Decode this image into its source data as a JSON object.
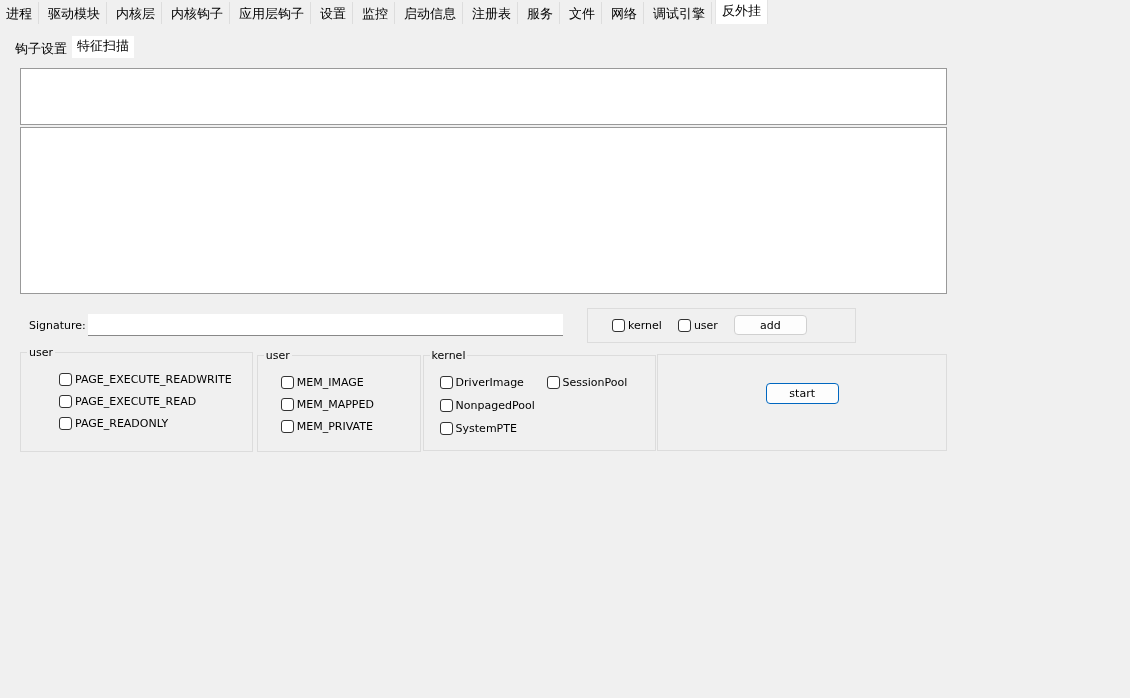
{
  "tabs": [
    {
      "label": "进程",
      "selected": false
    },
    {
      "label": "驱动模块",
      "selected": false
    },
    {
      "label": "内核层",
      "selected": false
    },
    {
      "label": "内核钩子",
      "selected": false
    },
    {
      "label": "应用层钩子",
      "selected": false
    },
    {
      "label": "设置",
      "selected": false
    },
    {
      "label": "监控",
      "selected": false
    },
    {
      "label": "启动信息",
      "selected": false
    },
    {
      "label": "注册表",
      "selected": false
    },
    {
      "label": "服务",
      "selected": false
    },
    {
      "label": "文件",
      "selected": false
    },
    {
      "label": "网络",
      "selected": false
    },
    {
      "label": "调试引擎",
      "selected": false
    },
    {
      "label": "反外挂",
      "selected": true
    }
  ],
  "subtabs": [
    {
      "label": "钩子设置",
      "selected": false
    },
    {
      "label": "特征扫描",
      "selected": true
    }
  ],
  "signature": {
    "label": "Signature:"
  },
  "add_panel": {
    "options": [
      {
        "label": "kernel",
        "checked": false
      },
      {
        "label": "user",
        "checked": false
      }
    ],
    "button": "add"
  },
  "groups": [
    {
      "title": "user",
      "kind": "list",
      "options": [
        {
          "label": "PAGE_EXECUTE_READWRITE",
          "checked": false
        },
        {
          "label": "PAGE_EXECUTE_READ",
          "checked": false
        },
        {
          "label": "PAGE_READONLY",
          "checked": false
        }
      ]
    },
    {
      "title": "user",
      "kind": "list",
      "options": [
        {
          "label": "MEM_IMAGE",
          "checked": false
        },
        {
          "label": "MEM_MAPPED",
          "checked": false
        },
        {
          "label": "MEM_PRIVATE",
          "checked": false
        }
      ]
    },
    {
      "title": "kernel",
      "kind": "grid",
      "options": [
        {
          "label": "DriverImage",
          "checked": false
        },
        {
          "label": "NonpagedPool",
          "checked": false
        },
        {
          "label": "SystemPTE",
          "checked": false
        },
        {
          "label": "SessionPool",
          "checked": false
        }
      ]
    }
  ],
  "start_button": "start"
}
